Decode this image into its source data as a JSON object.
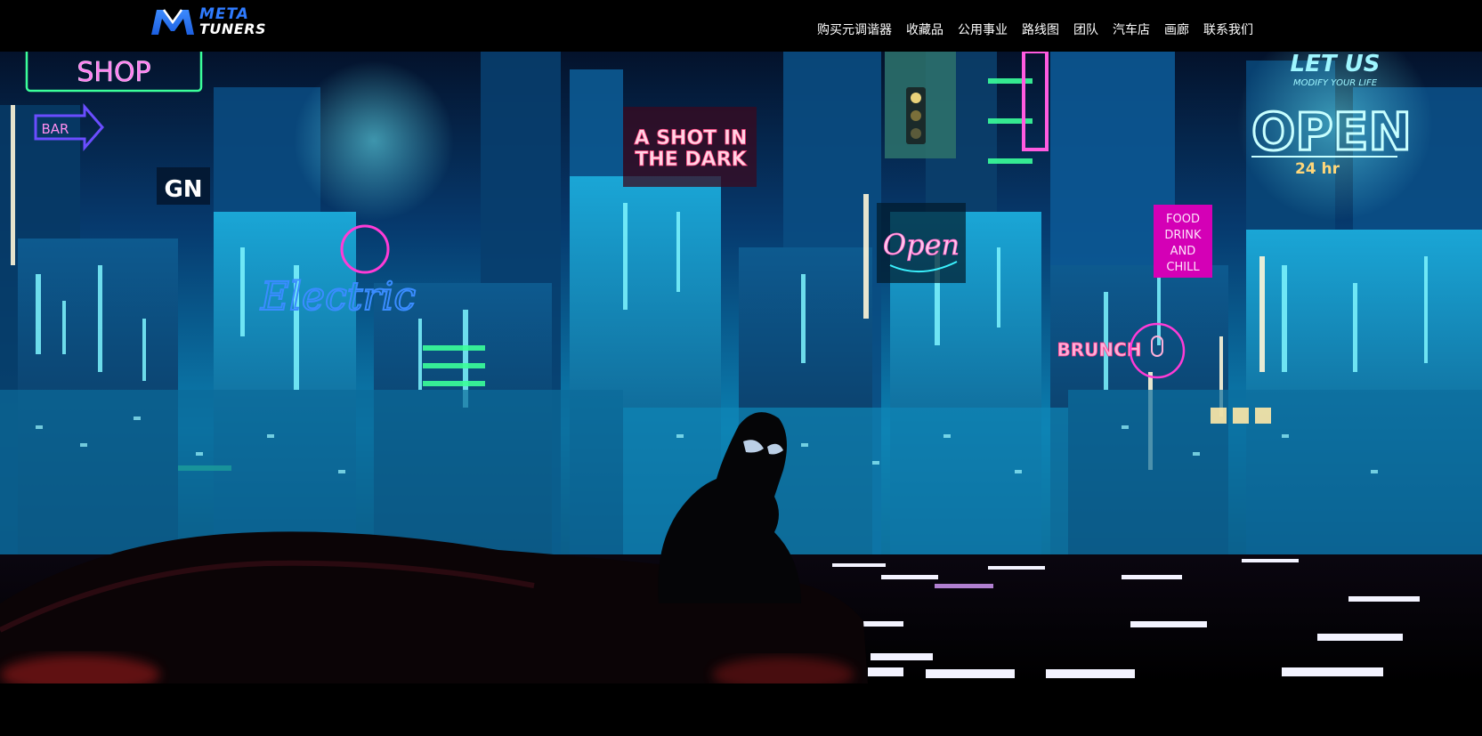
{
  "brand": {
    "logo_line1": "META",
    "logo_line2": "TUNERS",
    "accent": "#2f7bff"
  },
  "nav": {
    "items": [
      {
        "label": "购买元调谐器"
      },
      {
        "label": "收藏品"
      },
      {
        "label": "公用事业"
      },
      {
        "label": "路线图"
      },
      {
        "label": "团队"
      },
      {
        "label": "汽车店"
      },
      {
        "label": "画廊"
      },
      {
        "label": "联系我们"
      }
    ]
  },
  "hero": {
    "signs": {
      "psychic_shop": "SHOP",
      "bar": "BAR",
      "gn": "GN",
      "shot1": "A SHOT IN",
      "shot2": "THE DARK",
      "open_script": "Open",
      "food1": "FOOD",
      "food2": "DRINK",
      "food3": "AND",
      "food4": "CHILL",
      "brunch": "BRUNCH",
      "electric": "Electric",
      "let_us": "LET US",
      "modify": "MODIFY YOUR LIFE",
      "open_big": "OPEN",
      "hours": "24 hr"
    },
    "colors": {
      "cyan": "#19e0ff",
      "blue": "#1a6cff",
      "magenta": "#ff3bd6",
      "pink": "#ff4a8c",
      "green": "#27ff9a",
      "deep": "#031a3a"
    }
  }
}
